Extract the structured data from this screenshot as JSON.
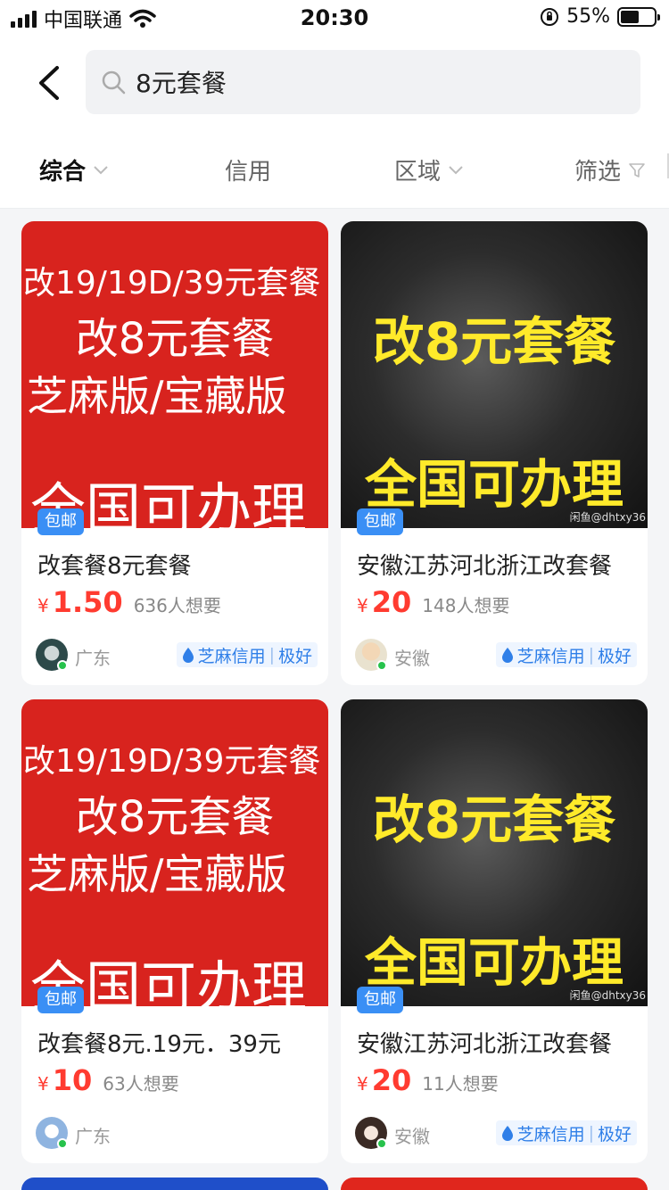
{
  "status": {
    "carrier": "中国联通",
    "time": "20:30",
    "battery": "55%",
    "battery_level": 0.55
  },
  "header": {
    "search_query": "8元套餐"
  },
  "filters": [
    {
      "label": "综合",
      "active": true,
      "icon": "chevron-down-icon"
    },
    {
      "label": "信用",
      "active": false
    },
    {
      "label": "区域",
      "active": false,
      "icon": "chevron-down-icon"
    },
    {
      "label": "筛选",
      "active": false,
      "icon": "funnel-icon"
    }
  ],
  "cards": [
    {
      "image_lines": [
        "改19/19D/39元套餐",
        "改8元套餐",
        "芝麻版/宝藏版",
        "全国可办理"
      ],
      "badge": "包邮",
      "title": "改套餐8元套餐",
      "currency": "¥",
      "price": "1.50",
      "want": "636人想要",
      "region": "广东",
      "credit_label": "芝麻信用",
      "credit_level": "极好"
    },
    {
      "image_lines": [
        "改8元套餐",
        "全国可办理"
      ],
      "watermark": "闲鱼@dhtxy36",
      "badge": "包邮",
      "title": "安徽江苏河北浙江改套餐",
      "currency": "¥",
      "price": "20",
      "want": "148人想要",
      "region": "安徽",
      "credit_label": "芝麻信用",
      "credit_level": "极好"
    },
    {
      "image_lines": [
        "改19/19D/39元套餐",
        "改8元套餐",
        "芝麻版/宝藏版",
        "全国可办理"
      ],
      "badge": "包邮",
      "title": "改套餐8元.19元．39元",
      "currency": "¥",
      "price": "10",
      "want": "63人想要",
      "region": "广东",
      "credit_label": "",
      "credit_level": ""
    },
    {
      "image_lines": [
        "改8元套餐",
        "全国可办理"
      ],
      "watermark": "闲鱼@dhtxy36",
      "badge": "包邮",
      "title": "安徽江苏河北浙江改套餐",
      "currency": "¥",
      "price": "20",
      "want": "11人想要",
      "region": "安徽",
      "credit_label": "芝麻信用",
      "credit_level": "极好"
    }
  ],
  "colors": {
    "price": "#ff3b30",
    "badge": "#3a8ff5",
    "credit": "#2f7fe8",
    "red_thumb": "#d8231e",
    "yellow_text": "#ffea2a"
  }
}
